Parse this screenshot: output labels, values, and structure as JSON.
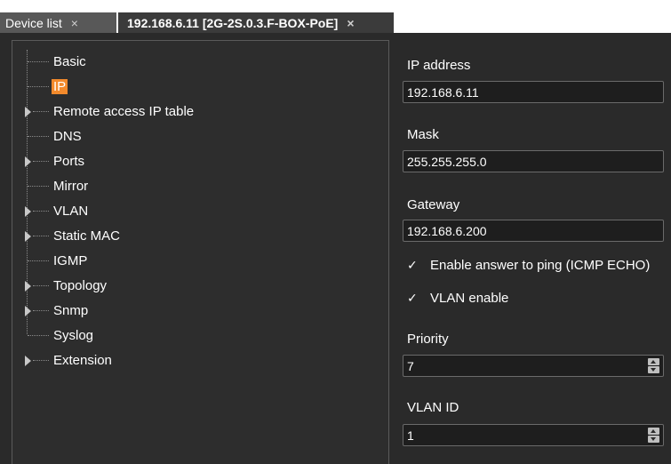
{
  "tabs": [
    {
      "label": "Device list",
      "close": "×"
    },
    {
      "label": "192.168.6.11 [2G-2S.0.3.F-BOX-PoE]",
      "close": "×"
    }
  ],
  "tree": {
    "items": [
      {
        "label": "Basic",
        "expandable": false
      },
      {
        "label": "IP",
        "expandable": false,
        "selected": true
      },
      {
        "label": "Remote access IP table",
        "expandable": true
      },
      {
        "label": "DNS",
        "expandable": false
      },
      {
        "label": "Ports",
        "expandable": true
      },
      {
        "label": "Mirror",
        "expandable": false
      },
      {
        "label": "VLAN",
        "expandable": true
      },
      {
        "label": "Static MAC",
        "expandable": true
      },
      {
        "label": "IGMP",
        "expandable": false
      },
      {
        "label": "Topology",
        "expandable": true
      },
      {
        "label": "Snmp",
        "expandable": true
      },
      {
        "label": "Syslog",
        "expandable": false
      },
      {
        "label": "Extension",
        "expandable": true
      }
    ]
  },
  "settings": {
    "ip_label": "IP address",
    "ip_value": "192.168.6.11",
    "mask_label": "Mask",
    "mask_value": "255.255.255.0",
    "gateway_label": "Gateway",
    "gateway_value": "192.168.6.200",
    "ping_label": "Enable answer to ping (ICMP ECHO)",
    "ping_checked": true,
    "vlan_enable_label": "VLAN enable",
    "vlan_enable_checked": true,
    "priority_label": "Priority",
    "priority_value": "7",
    "vlan_id_label": "VLAN ID",
    "vlan_id_value": "1",
    "check_glyph": "✓"
  },
  "colors": {
    "background": "#2a2a2a",
    "selection": "#f28a2c",
    "active_tab": "#3b3b3b",
    "inactive_tab": "#585858"
  }
}
